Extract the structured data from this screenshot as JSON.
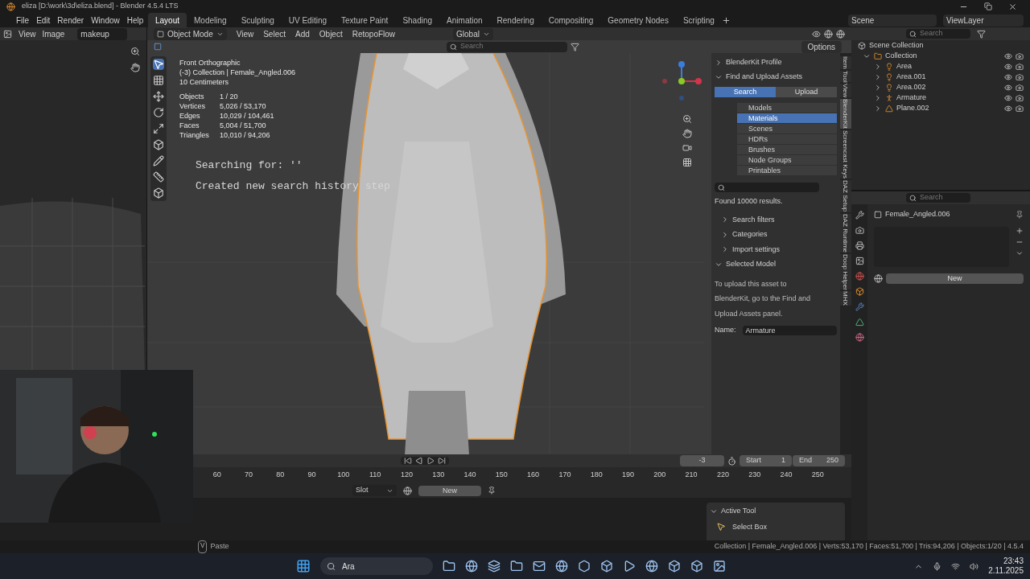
{
  "title_bar": {
    "title": "eliza [D:\\work\\3d\\eliza.blend] - Blender 4.5.4 LTS"
  },
  "menu": [
    "File",
    "Edit",
    "Render",
    "Window",
    "Help"
  ],
  "workspaces": [
    {
      "label": "Layout",
      "selected": true
    },
    {
      "label": "Modeling",
      "selected": false
    },
    {
      "label": "Sculpting",
      "selected": false
    },
    {
      "label": "UV Editing",
      "selected": false
    },
    {
      "label": "Texture Paint",
      "selected": false
    },
    {
      "label": "Shading",
      "selected": false
    },
    {
      "label": "Animation",
      "selected": false
    },
    {
      "label": "Rendering",
      "selected": false
    },
    {
      "label": "Compositing",
      "selected": false
    },
    {
      "label": "Geometry Nodes",
      "selected": false
    },
    {
      "label": "Scripting",
      "selected": false
    }
  ],
  "scene": "Scene",
  "view_layer": "ViewLayer",
  "image_editor": {
    "menus": [
      "View",
      "Image"
    ],
    "image_name": "makeup"
  },
  "viewport": {
    "mode": "Object Mode",
    "menus": [
      "View",
      "Select",
      "Add",
      "Object",
      "RetopoFlow"
    ],
    "orientation": "Global",
    "search_placeholder": "Search",
    "options": "Options",
    "info": [
      "Front Orthographic",
      "(-3) Collection | Female_Angled.006",
      "10 Centimeters"
    ],
    "stats": [
      {
        "label": "Objects",
        "value": "1 / 20"
      },
      {
        "label": "Vertices",
        "value": "5,026 / 53,170"
      },
      {
        "label": "Edges",
        "value": "10,029 / 104,461"
      },
      {
        "label": "Faces",
        "value": "5,004 / 51,700"
      },
      {
        "label": "Triangles",
        "value": "10,010 / 94,206"
      }
    ],
    "log": [
      "Searching for: ''",
      "Created new search history step"
    ]
  },
  "blenderkit": {
    "sections": [
      {
        "label": "BlenderKit Profile",
        "expanded": false
      },
      {
        "label": "Find and Upload Assets",
        "expanded": true
      }
    ],
    "tabs": [
      {
        "label": "Search",
        "selected": true
      },
      {
        "label": "Upload",
        "selected": false
      }
    ],
    "asset_types": [
      {
        "label": "Models",
        "selected": false
      },
      {
        "label": "Materials",
        "selected": true
      },
      {
        "label": "Scenes",
        "selected": false
      },
      {
        "label": "HDRs",
        "selected": false
      },
      {
        "label": "Brushes",
        "selected": false
      },
      {
        "label": "Node Groups",
        "selected": false
      },
      {
        "label": "Printables",
        "selected": false
      }
    ],
    "results": "Found 10000 results.",
    "subsections": [
      {
        "label": "Search filters",
        "expanded": false
      },
      {
        "label": "Categories",
        "expanded": false
      },
      {
        "label": "Import settings",
        "expanded": false
      },
      {
        "label": "Selected Model",
        "expanded": true
      }
    ],
    "upload_note": [
      "To upload this asset to",
      "BlenderKit, go to the Find and",
      "Upload Assets panel."
    ],
    "name_label": "Name:",
    "name_value": "Armature"
  },
  "sidebar_tabs": [
    {
      "label": "Item",
      "selected": false
    },
    {
      "label": "Tool",
      "selected": false
    },
    {
      "label": "View",
      "selected": false
    },
    {
      "label": "BlenderKit",
      "selected": true
    },
    {
      "label": "Screencast Keys",
      "selected": false
    },
    {
      "label": "DAZ Setup",
      "selected": false
    },
    {
      "label": "DAZ Runtime",
      "selected": false
    },
    {
      "label": "Doop Helper",
      "selected": false
    },
    {
      "label": "MHX",
      "selected": false
    }
  ],
  "outliner": {
    "search_placeholder": "Search",
    "root": "Scene Collection",
    "items": [
      {
        "label": "Collection",
        "kind": "collection",
        "expanded": true,
        "children": [
          {
            "label": "Area",
            "kind": "light",
            "expanded": false
          },
          {
            "label": "Area.001",
            "kind": "light",
            "expanded": false
          },
          {
            "label": "Area.002",
            "kind": "light",
            "expanded": false
          },
          {
            "label": "Armature",
            "kind": "armature",
            "expanded": false
          },
          {
            "label": "Plane.002",
            "kind": "mesh",
            "expanded": false
          }
        ]
      }
    ]
  },
  "properties": {
    "search_placeholder": "Search",
    "object": "Female_Angled.006",
    "new_button": "New"
  },
  "timeline": {
    "current_frame": "-3",
    "start_label": "Start",
    "start": "1",
    "end_label": "End",
    "end": "250",
    "ruler": [
      "60",
      "70",
      "80",
      "90",
      "100",
      "110",
      "120",
      "130",
      "140",
      "150",
      "160",
      "170",
      "180",
      "190",
      "200",
      "210",
      "220",
      "230",
      "240",
      "250"
    ]
  },
  "shader_header": {
    "slot": "Slot",
    "new_button": "New"
  },
  "active_tool": {
    "title": "Active Tool",
    "tool": "Select Box"
  },
  "status_bar": {
    "hint_key": "V",
    "hint": "Paste",
    "stats": "Collection | Female_Angled.006 | Verts:53,170 | Faces:51,700 | Tris:94,206 | Objects:1/20 | 4.5.4"
  },
  "taskbar": {
    "search_placeholder": "Ara",
    "time": "23:43",
    "date": "2.11.2025"
  }
}
